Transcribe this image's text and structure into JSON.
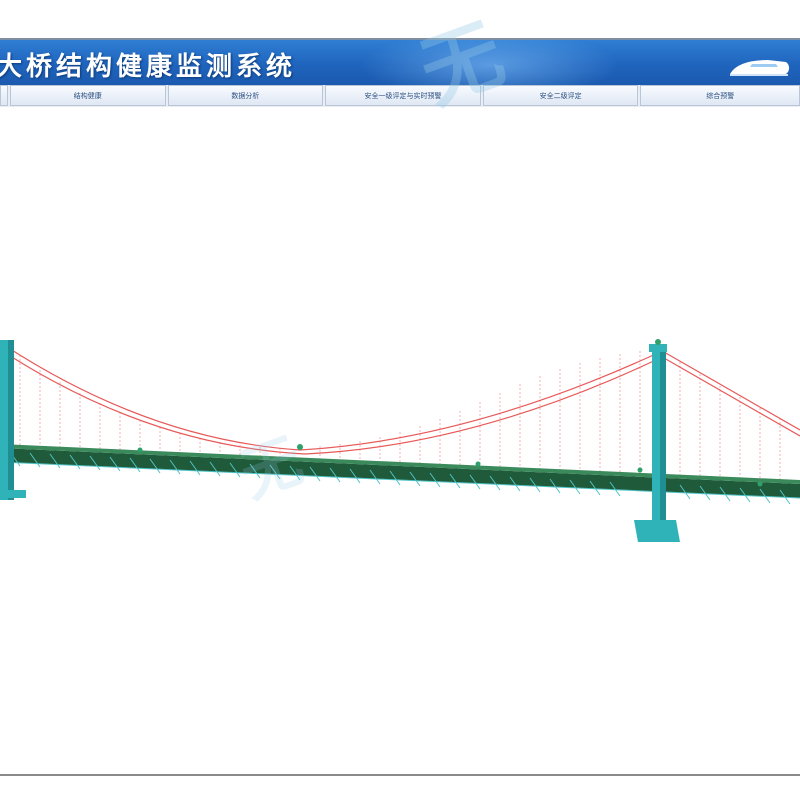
{
  "header": {
    "title": "大桥结构健康监测系统",
    "logo_icon": "high-speed-train-icon"
  },
  "nav": {
    "tabs": [
      {
        "label": "",
        "width": 8
      },
      {
        "label": "结构健康",
        "width": 156
      },
      {
        "label": "数据分析",
        "width": 156
      },
      {
        "label": "安全一级评定与实时预警",
        "width": 156
      },
      {
        "label": "安全二级评定",
        "width": 156
      },
      {
        "label": "综合预警",
        "width": 160
      }
    ]
  },
  "colors": {
    "header_blue": "#1f64bd",
    "tower": "#2fb3b8",
    "deck": "#1f5a3a",
    "cable": "#e85a5a",
    "hanger": "#f2a8a8"
  }
}
